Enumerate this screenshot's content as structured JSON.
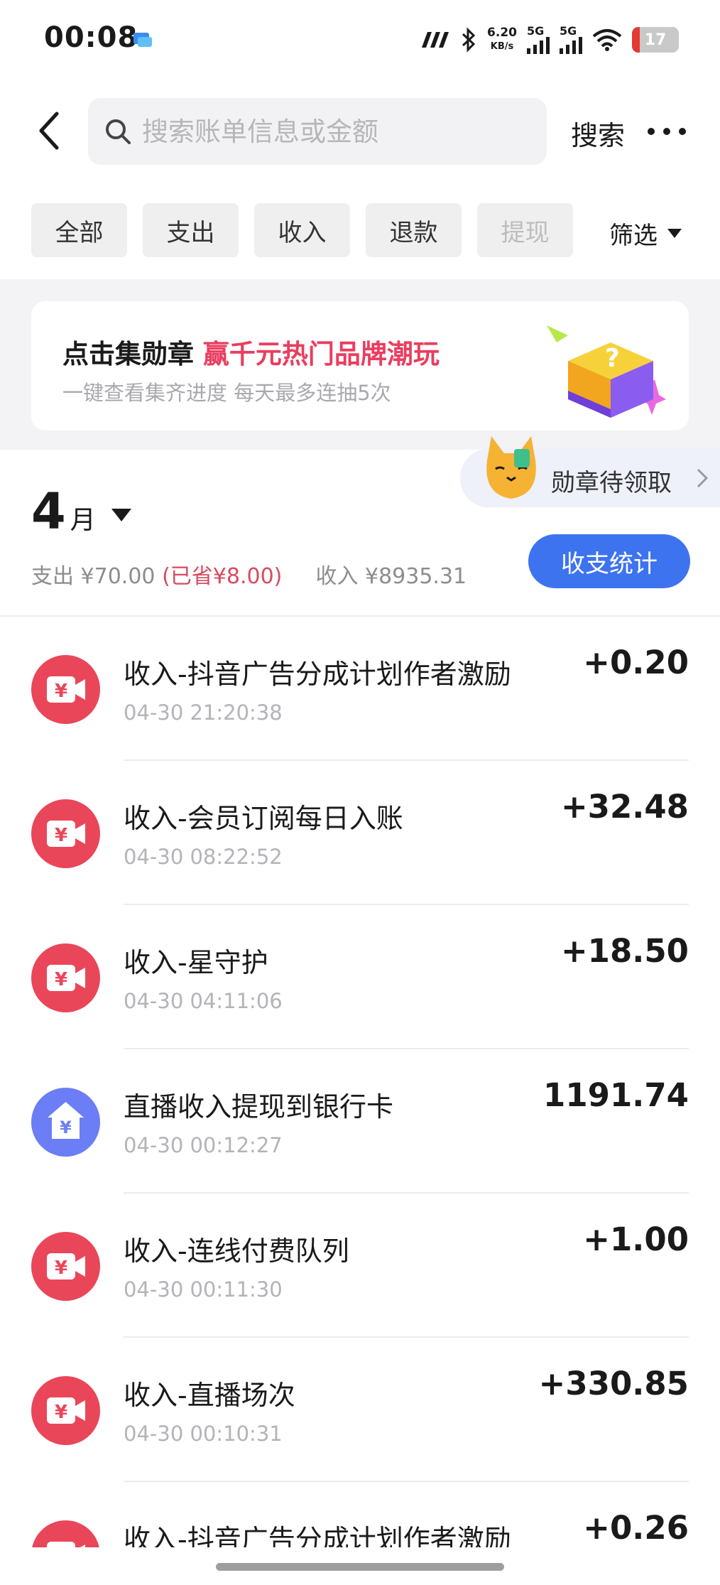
{
  "status_bar": {
    "time": "00:08",
    "net_speed_value": "6.20",
    "net_speed_unit": "KB/s",
    "sim1_label": "5G",
    "sim2_label": "5G",
    "battery": "17",
    "battery_level": 0.17
  },
  "header": {
    "search_placeholder": "搜索账单信息或金额",
    "search_button": "搜索"
  },
  "filters": {
    "chips": [
      "全部",
      "支出",
      "收入",
      "退款",
      "提现"
    ],
    "filter_label": "筛选"
  },
  "banner": {
    "title_plain": "点击集勋章 ",
    "title_highlight": "赢千元热门品牌潮玩",
    "subtitle": "一键查看集齐进度 每天最多连抽5次"
  },
  "medal_tab": {
    "label": "勋章待领取"
  },
  "month_summary": {
    "month_number": "4",
    "month_unit": "月",
    "expense": "支出 ¥70.00",
    "saved": "(已省¥8.00)",
    "income": "收入 ¥8935.31",
    "stats_button": "收支统计"
  },
  "transactions": [
    {
      "title": "收入-抖音广告分成计划作者激励",
      "time": "04-30 21:20:38",
      "amount": "+0.20",
      "icon": "yuan-video-icon"
    },
    {
      "title": "收入-会员订阅每日入账",
      "time": "04-30 08:22:52",
      "amount": "+32.48",
      "icon": "yuan-video-icon"
    },
    {
      "title": "收入-星守护",
      "time": "04-30 04:11:06",
      "amount": "+18.50",
      "icon": "yuan-video-icon"
    },
    {
      "title": "直播收入提现到银行卡",
      "time": "04-30 00:12:27",
      "amount": "1191.74",
      "icon": "withdraw-house-icon"
    },
    {
      "title": "收入-连线付费队列",
      "time": "04-30 00:11:30",
      "amount": "+1.00",
      "icon": "yuan-video-icon"
    },
    {
      "title": "收入-直播场次",
      "time": "04-30 00:10:31",
      "amount": "+330.85",
      "icon": "yuan-video-icon"
    },
    {
      "title": "收入-抖音广告分成计划作者激励",
      "time": "",
      "amount": "+0.26",
      "icon": "yuan-video-icon"
    }
  ],
  "colors": {
    "accent_blue": "#3e73f0",
    "income_icon_red": "#ea4659",
    "withdraw_icon_blue": "#6b7ef5",
    "highlight_red": "#ea3d5f"
  }
}
